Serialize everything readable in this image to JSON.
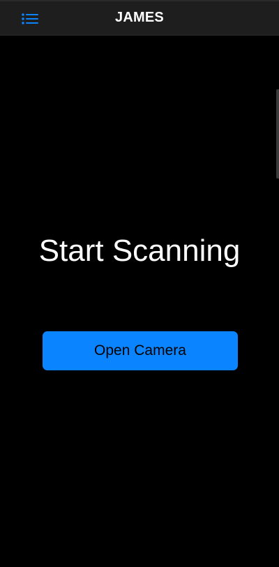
{
  "header": {
    "title": "JAMES",
    "menu_icon": "list-menu-icon"
  },
  "main": {
    "headline": "Start Scanning",
    "open_camera_label": "Open Camera"
  },
  "colors": {
    "background": "#000000",
    "header_bg": "#1e1e1e",
    "accent": "#0a84ff",
    "title_text": "#ffffff"
  }
}
